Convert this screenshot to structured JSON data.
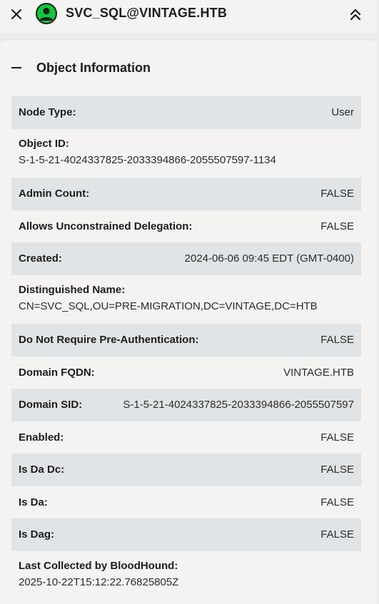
{
  "header": {
    "title": "SVC_SQL@VINTAGE.HTB",
    "close_icon": "close-icon",
    "avatar_icon": "user-icon",
    "collapse_icon": "chevron-double-up-icon",
    "avatar_color": "#12c83b"
  },
  "section": {
    "title": "Object Information",
    "toggle_icon": "minus-icon"
  },
  "rows": [
    {
      "label": "Node Type:",
      "value": "User"
    },
    {
      "label": "Object ID:",
      "value": "S-1-5-21-4024337825-2033394866-2055507597-1134"
    },
    {
      "label": "Admin Count:",
      "value": "FALSE"
    },
    {
      "label": "Allows Unconstrained Delegation:",
      "value": "FALSE"
    },
    {
      "label": "Created:",
      "value": "2024-06-06 09:45 EDT (GMT-0400)"
    },
    {
      "label": "Distinguished Name:",
      "value": "CN=SVC_SQL,OU=PRE-MIGRATION,DC=VINTAGE,DC=HTB"
    },
    {
      "label": "Do Not Require Pre-Authentication:",
      "value": "FALSE"
    },
    {
      "label": "Domain FQDN:",
      "value": "VINTAGE.HTB"
    },
    {
      "label": "Domain SID:",
      "value": "S-1-5-21-4024337825-2033394866-2055507597"
    },
    {
      "label": "Enabled:",
      "value": "FALSE"
    },
    {
      "label": "Is Da Dc:",
      "value": "FALSE"
    },
    {
      "label": "Is Da:",
      "value": "FALSE"
    },
    {
      "label": "Is Dag:",
      "value": "FALSE"
    },
    {
      "label": "Last Collected by BloodHound:",
      "value": "2025-10-22T15:12:22.76825805Z"
    }
  ]
}
